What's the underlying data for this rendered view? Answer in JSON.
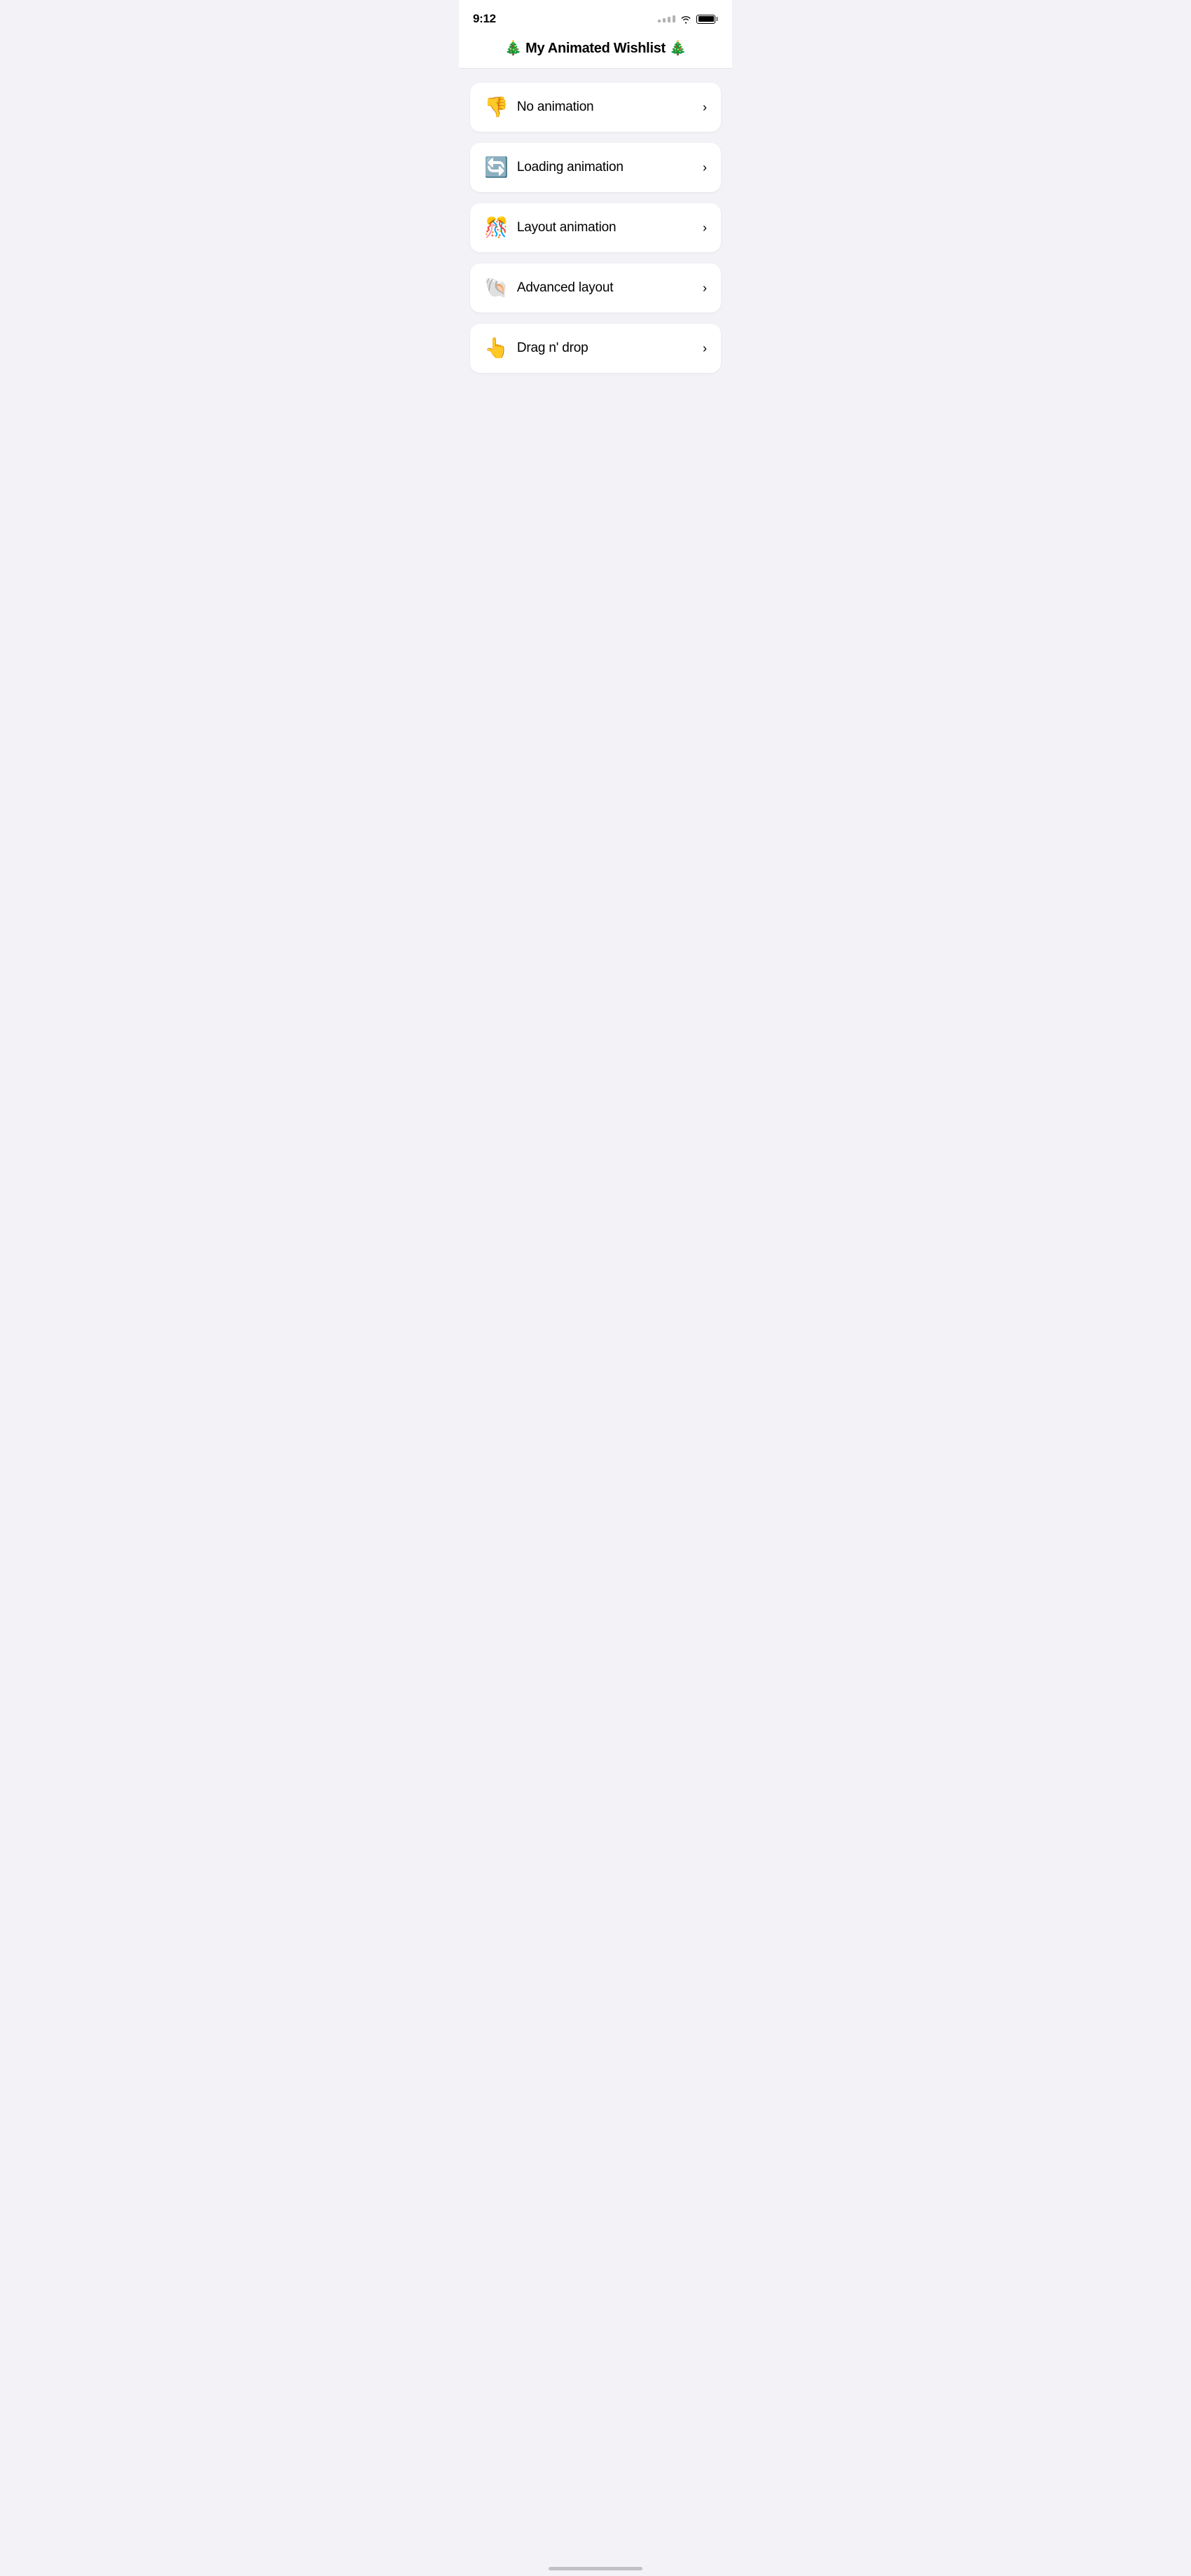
{
  "statusBar": {
    "time": "9:12",
    "wifiAlt": "wifi signal",
    "batteryAlt": "battery"
  },
  "header": {
    "title": "🎄 My Animated Wishlist 🎄"
  },
  "menuItems": [
    {
      "id": "no-animation",
      "emoji": "👎",
      "label": "No animation",
      "chevron": "›"
    },
    {
      "id": "loading-animation",
      "emoji": "🔄",
      "label": "Loading animation",
      "chevron": "›"
    },
    {
      "id": "layout-animation",
      "emoji": "🎊",
      "label": "Layout animation",
      "chevron": "›"
    },
    {
      "id": "advanced-layout",
      "emoji": "🐚",
      "label": "Advanced layout",
      "chevron": "›"
    },
    {
      "id": "drag-n-drop",
      "emoji": "👆",
      "label": "Drag n' drop",
      "chevron": "›"
    }
  ],
  "homeIndicator": {
    "ariaLabel": "home indicator"
  }
}
